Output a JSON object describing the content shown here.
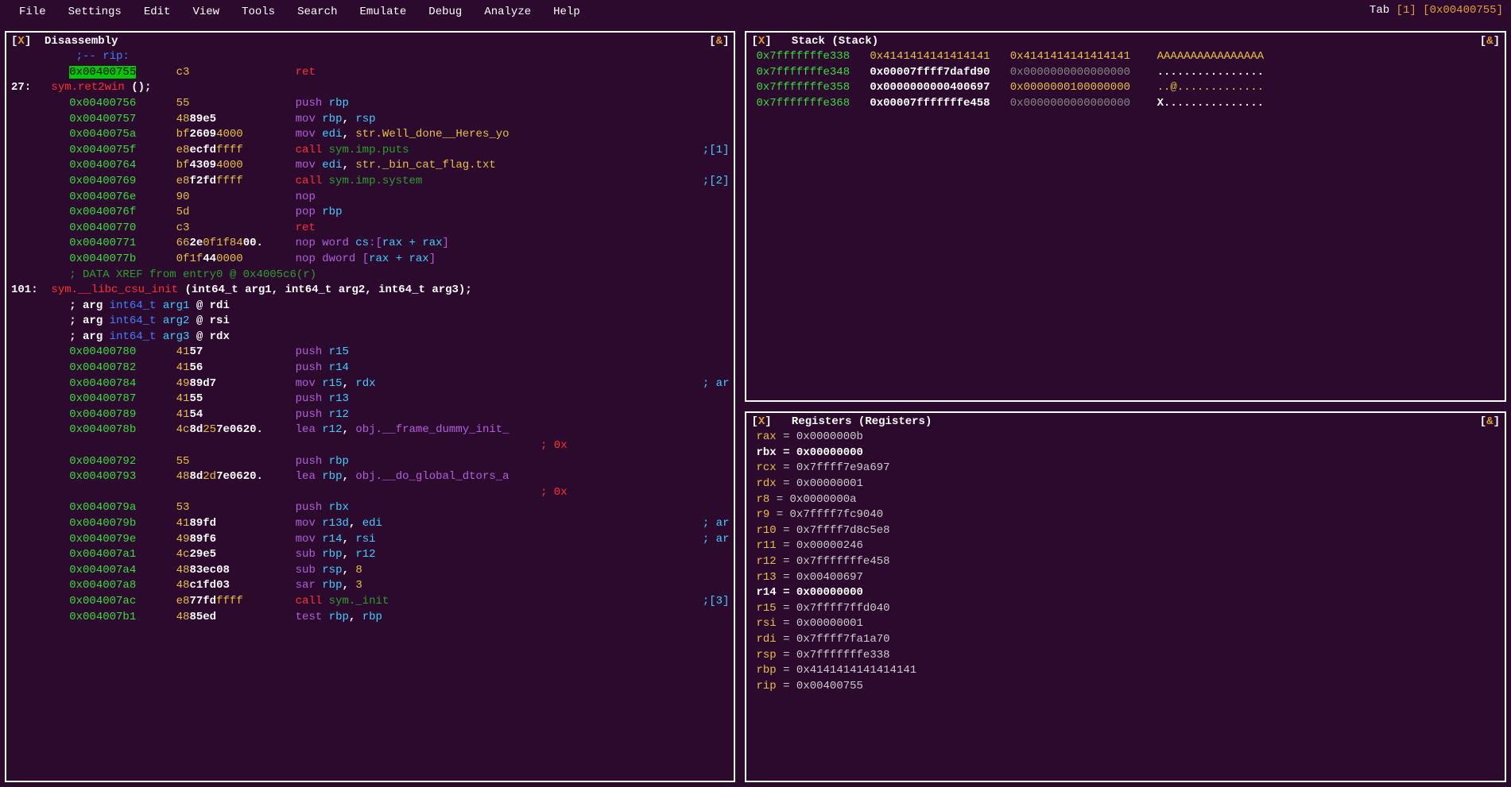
{
  "menubar": {
    "items": [
      "File",
      "Settings",
      "Edit",
      "View",
      "Tools",
      "Search",
      "Emulate",
      "Debug",
      "Analyze",
      "Help"
    ],
    "tab_label": "Tab",
    "tab_num": "[1]",
    "tab_addr": "[0x00400755]"
  },
  "disasm": {
    "title": "Disassembly",
    "close": "[X]",
    "opt": "[&]",
    "lines": [
      {
        "comment": ";-- rip:"
      },
      {
        "addr": "0x00400755",
        "hl": true,
        "bytes": "c3",
        "mnem": "ret"
      },
      {
        "fnheader": true,
        "num": "27:",
        "sym": "sym.ret2win",
        "sig": " ();"
      },
      {
        "addr": "0x00400756",
        "bytes": "55",
        "mnem": "push",
        "ops": [
          {
            "t": "rbp",
            "cls": "c-cyan"
          }
        ]
      },
      {
        "addr": "0x00400757",
        "bytes1": "48",
        "bytes2": "89e5",
        "mnem": "mov",
        "ops": [
          {
            "t": "rbp",
            "cls": "c-cyan"
          },
          {
            "t": ", ",
            "cls": "c-white"
          },
          {
            "t": "rsp",
            "cls": "c-cyan"
          }
        ]
      },
      {
        "addr": "0x0040075a",
        "bytes1": "bf",
        "bytes2": "2609",
        "bytes3": "4000",
        "mnem": "mov",
        "ops": [
          {
            "t": "edi",
            "cls": "c-cyan"
          },
          {
            "t": ", ",
            "cls": "c-white"
          },
          {
            "t": "str.Well_done__Heres_yo",
            "cls": "c-yellow"
          }
        ]
      },
      {
        "addr": "0x0040075f",
        "bytes1": "e8",
        "bytes2": "ecfd",
        "bytes3": "ffff",
        "mnem": "call",
        "ops": [
          {
            "t": "sym.imp.puts",
            "cls": "c-dgreen"
          }
        ],
        "tail": ";[1]",
        "tailcls": "c-cyan"
      },
      {
        "addr": "0x00400764",
        "bytes1": "bf",
        "bytes2": "4309",
        "bytes3": "4000",
        "mnem": "mov",
        "ops": [
          {
            "t": "edi",
            "cls": "c-cyan"
          },
          {
            "t": ", ",
            "cls": "c-white"
          },
          {
            "t": "str._bin_cat_flag.txt",
            "cls": "c-yellow"
          }
        ]
      },
      {
        "addr": "0x00400769",
        "bytes1": "e8",
        "bytes2": "f2fd",
        "bytes3": "ffff",
        "mnem": "call",
        "ops": [
          {
            "t": "sym.imp.system",
            "cls": "c-dgreen"
          }
        ],
        "tail": ";[2]",
        "tailcls": "c-cyan"
      },
      {
        "addr": "0x0040076e",
        "bytes": "90",
        "mnem": "nop"
      },
      {
        "addr": "0x0040076f",
        "bytes1": "5d",
        "mnem": "pop",
        "ops": [
          {
            "t": "rbp",
            "cls": "c-cyan"
          }
        ]
      },
      {
        "addr": "0x00400770",
        "bytes": "c3",
        "mnem": "ret"
      },
      {
        "addr": "0x00400771",
        "bytes1": "66",
        "bytes2": "2e",
        "bytes3": "0f1f84",
        "bytes4": "00",
        "btail": ".",
        "mnem": "nop word",
        "ops": [
          {
            "t": "cs",
            "cls": "c-cyan"
          },
          {
            "t": ":[",
            "cls": "c-purple"
          },
          {
            "t": "rax + rax",
            "cls": "c-cyan"
          },
          {
            "t": "]",
            "cls": "c-purple"
          }
        ]
      },
      {
        "addr": "0x0040077b",
        "bytes1": "0f1f",
        "bytes2": "44",
        "bytes3": "0000",
        "mnem": "nop dword",
        "ops": [
          {
            "t": "[",
            "cls": "c-purple"
          },
          {
            "t": "rax + rax",
            "cls": "c-cyan"
          },
          {
            "t": "]",
            "cls": "c-purple"
          }
        ]
      },
      {
        "xref": "; DATA XREF from entry0 @ 0x4005c6(r)"
      },
      {
        "fnheader": true,
        "num": "101:",
        "sym": "sym.__libc_csu_init",
        "sig": " (int64_t arg1, int64_t arg2, int64_t arg3);"
      },
      {
        "arg": "; arg ",
        "type": "int64_t",
        "name": "arg1",
        "at": " @ rdi"
      },
      {
        "arg": "; arg ",
        "type": "int64_t",
        "name": "arg2",
        "at": " @ rsi"
      },
      {
        "arg": "; arg ",
        "type": "int64_t",
        "name": "arg3",
        "at": " @ rdx"
      },
      {
        "addr": "0x00400780",
        "bytes1": "41",
        "bytes2": "57",
        "mnem": "push",
        "ops": [
          {
            "t": "r15",
            "cls": "c-cyan"
          }
        ]
      },
      {
        "addr": "0x00400782",
        "bytes1": "41",
        "bytes2": "56",
        "mnem": "push",
        "ops": [
          {
            "t": "r14",
            "cls": "c-cyan"
          }
        ]
      },
      {
        "addr": "0x00400784",
        "bytes1": "49",
        "bytes2": "89d7",
        "mnem": "mov",
        "ops": [
          {
            "t": "r15",
            "cls": "c-cyan"
          },
          {
            "t": ", ",
            "cls": "c-white"
          },
          {
            "t": "rdx",
            "cls": "c-cyan"
          }
        ],
        "tail": "; ar",
        "tailcls": "c-cyan"
      },
      {
        "addr": "0x00400787",
        "bytes1": "41",
        "bytes2": "55",
        "mnem": "push",
        "ops": [
          {
            "t": "r13",
            "cls": "c-cyan"
          }
        ]
      },
      {
        "addr": "0x00400789",
        "bytes1": "41",
        "bytes2": "54",
        "mnem": "push",
        "ops": [
          {
            "t": "r12",
            "cls": "c-cyan"
          }
        ]
      },
      {
        "addr": "0x0040078b",
        "bytes1": "4c",
        "bytes2": "8d",
        "bytes3": "25",
        "bytes4": "7e0620",
        "btail": ".",
        "mnem": "lea",
        "ops": [
          {
            "t": "r12",
            "cls": "c-cyan"
          },
          {
            "t": ", ",
            "cls": "c-white"
          },
          {
            "t": "obj.__frame_dummy_init_",
            "cls": "c-purple"
          }
        ]
      },
      {
        "contcomment": "; 0x"
      },
      {
        "addr": "0x00400792",
        "bytes": "55",
        "mnem": "push",
        "ops": [
          {
            "t": "rbp",
            "cls": "c-cyan"
          }
        ]
      },
      {
        "addr": "0x00400793",
        "bytes1": "48",
        "bytes2": "8d",
        "bytes3": "2d",
        "bytes4": "7e0620",
        "btail": ".",
        "mnem": "lea",
        "ops": [
          {
            "t": "rbp",
            "cls": "c-cyan"
          },
          {
            "t": ", ",
            "cls": "c-white"
          },
          {
            "t": "obj.__do_global_dtors_a",
            "cls": "c-purple"
          }
        ]
      },
      {
        "contcomment": "; 0x"
      },
      {
        "addr": "0x0040079a",
        "bytes": "53",
        "mnem": "push",
        "ops": [
          {
            "t": "rbx",
            "cls": "c-cyan"
          }
        ]
      },
      {
        "addr": "0x0040079b",
        "bytes1": "41",
        "bytes2": "89fd",
        "mnem": "mov",
        "ops": [
          {
            "t": "r13d",
            "cls": "c-cyan"
          },
          {
            "t": ", ",
            "cls": "c-white"
          },
          {
            "t": "edi",
            "cls": "c-cyan"
          }
        ],
        "tail": "; ar",
        "tailcls": "c-cyan"
      },
      {
        "addr": "0x0040079e",
        "bytes1": "49",
        "bytes2": "89f6",
        "mnem": "mov",
        "ops": [
          {
            "t": "r14",
            "cls": "c-cyan"
          },
          {
            "t": ", ",
            "cls": "c-white"
          },
          {
            "t": "rsi",
            "cls": "c-cyan"
          }
        ],
        "tail": "; ar",
        "tailcls": "c-cyan"
      },
      {
        "addr": "0x004007a1",
        "bytes1": "4c",
        "bytes2": "29e5",
        "mnem": "sub",
        "ops": [
          {
            "t": "rbp",
            "cls": "c-cyan"
          },
          {
            "t": ", ",
            "cls": "c-white"
          },
          {
            "t": "r12",
            "cls": "c-cyan"
          }
        ]
      },
      {
        "addr": "0x004007a4",
        "bytes1": "48",
        "bytes2": "83ec08",
        "mnem": "sub",
        "ops": [
          {
            "t": "rsp",
            "cls": "c-cyan"
          },
          {
            "t": ", ",
            "cls": "c-white"
          },
          {
            "t": "8",
            "cls": "c-yellow"
          }
        ]
      },
      {
        "addr": "0x004007a8",
        "bytes1": "48",
        "bytes2": "c1fd03",
        "mnem": "sar",
        "ops": [
          {
            "t": "rbp",
            "cls": "c-cyan"
          },
          {
            "t": ", ",
            "cls": "c-white"
          },
          {
            "t": "3",
            "cls": "c-yellow"
          }
        ]
      },
      {
        "addr": "0x004007ac",
        "bytes1": "e8",
        "bytes2": "77fd",
        "bytes3": "ffff",
        "mnem": "call",
        "ops": [
          {
            "t": "sym._init",
            "cls": "c-dgreen"
          }
        ],
        "tail": ";[3]",
        "tailcls": "c-cyan"
      },
      {
        "addr": "0x004007b1",
        "bytes1": "48",
        "bytes2": "85ed",
        "mnem": "test",
        "ops": [
          {
            "t": "rbp",
            "cls": "c-cyan"
          },
          {
            "t": ", ",
            "cls": "c-white"
          },
          {
            "t": "rbp",
            "cls": "c-cyan"
          }
        ]
      }
    ]
  },
  "stack": {
    "title": "Stack (Stack)",
    "rows": [
      {
        "addr": "0x7fffffffe338",
        "v1": "0x4141414141414141",
        "v2": "0x4141414141414141",
        "asc": "AAAAAAAAAAAAAAAA",
        "a1": "c-yellow",
        "a2": "c-yellow",
        "asccls": "c-yellow"
      },
      {
        "addr": "0x7fffffffe348",
        "v1": "0x00007ffff7dafd90",
        "v2": "0x0000000000000000",
        "asc": "................",
        "a1": "c-white",
        "a2": "",
        "asccls": "c-white"
      },
      {
        "addr": "0x7fffffffe358",
        "v1": "0x0000000000400697",
        "v2": "0x0000000100000000",
        "asc": "..@.............",
        "a1": "c-white",
        "a2": "c-yellow",
        "asccls": "c-yellow"
      },
      {
        "addr": "0x7fffffffe368",
        "v1": "0x00007fffffffe458",
        "v2": "0x0000000000000000",
        "asc": "X...............",
        "a1": "c-white",
        "a2": "",
        "asccls": "c-white"
      }
    ]
  },
  "registers": {
    "title": "Registers (Registers)",
    "items": [
      {
        "name": "rax",
        "val": "0x0000000b",
        "hl": false
      },
      {
        "name": "rbx",
        "val": "0x00000000",
        "hl": true
      },
      {
        "name": "rcx",
        "val": "0x7ffff7e9a697",
        "hl": false
      },
      {
        "name": "rdx",
        "val": "0x00000001",
        "hl": false
      },
      {
        "name": "r8",
        "val": "0x0000000a",
        "hl": false
      },
      {
        "name": "r9",
        "val": "0x7ffff7fc9040",
        "hl": false
      },
      {
        "name": "r10",
        "val": "0x7ffff7d8c5e8",
        "hl": false
      },
      {
        "name": "r11",
        "val": "0x00000246",
        "hl": false
      },
      {
        "name": "r12",
        "val": "0x7fffffffe458",
        "hl": false
      },
      {
        "name": "r13",
        "val": "0x00400697",
        "hl": false
      },
      {
        "name": "r14",
        "val": "0x00000000",
        "hl": true
      },
      {
        "name": "r15",
        "val": "0x7ffff7ffd040",
        "hl": false
      },
      {
        "name": "rsi",
        "val": "0x00000001",
        "hl": false
      },
      {
        "name": "rdi",
        "val": "0x7ffff7fa1a70",
        "hl": false
      },
      {
        "name": "rsp",
        "val": "0x7fffffffe338",
        "hl": false
      },
      {
        "name": "rbp",
        "val": "0x4141414141414141",
        "hl": false
      },
      {
        "name": "rip",
        "val": "0x00400755",
        "hl": false
      }
    ]
  }
}
